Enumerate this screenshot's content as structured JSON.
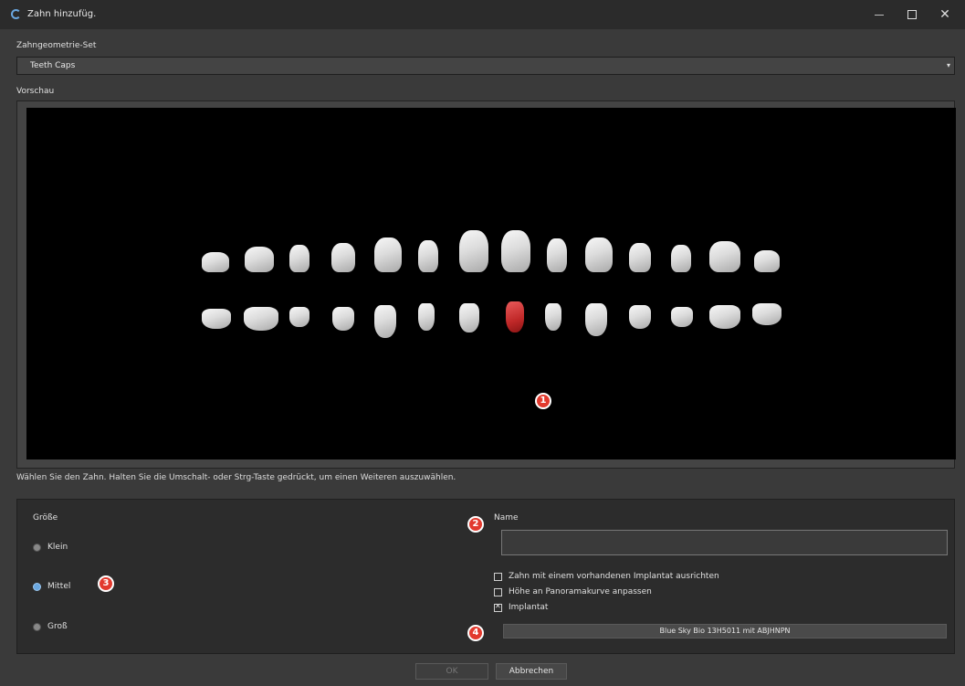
{
  "window": {
    "title": "Zahn hinzufüg.",
    "minimize": "—",
    "maximize": "□",
    "close": "✕"
  },
  "geometry_set": {
    "label": "Zahngeometrie-Set",
    "value": "Teeth Caps",
    "arrow": "▾"
  },
  "preview": {
    "label": "Vorschau",
    "selected_tooth_color": "#c02828",
    "upper_row_count": 14,
    "lower_row_count": 14
  },
  "hint": "Wählen Sie den Zahn. Halten Sie die Umschalt- oder Strg-Taste gedrückt, um einen Weiteren auszuwählen.",
  "size": {
    "label": "Größe",
    "options": [
      "Klein",
      "Mittel",
      "Groß"
    ],
    "selected": "Mittel"
  },
  "name": {
    "label": "Name",
    "value": ""
  },
  "options": [
    {
      "label": "Zahn mit einem vorhandenen Implantat ausrichten",
      "checked": false
    },
    {
      "label": "Höhe an Panoramakurve anpassen",
      "checked": false
    },
    {
      "label": "Implantat",
      "checked": true
    }
  ],
  "implant_button": "Blue Sky Bio 13H5011 mit ABJHNPN",
  "markers": [
    "1",
    "2",
    "3",
    "4"
  ],
  "buttons": {
    "ok": "OK",
    "cancel": "Abbrechen"
  }
}
